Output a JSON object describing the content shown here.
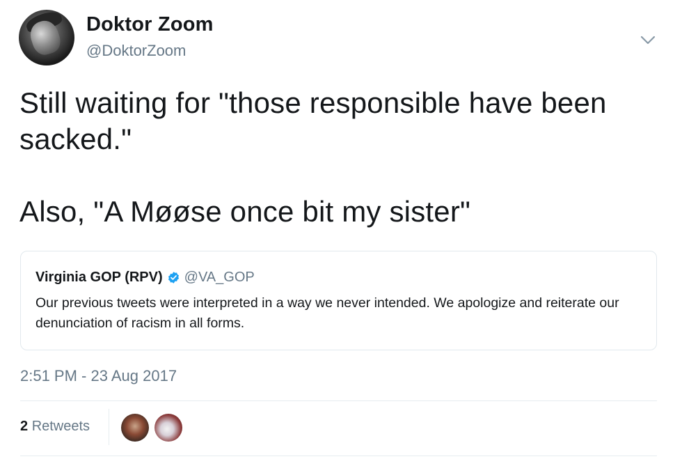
{
  "author": {
    "display_name": "Doktor Zoom",
    "handle": "@DoktorZoom",
    "avatar_icon": "user-avatar"
  },
  "menu": {
    "icon": "chevron-down-icon"
  },
  "tweet": {
    "text": "Still waiting for \"those responsible have been sacked.\"\n\nAlso, \"A Møøse once bit my sister\"",
    "timestamp": "2:51 PM - 23 Aug 2017"
  },
  "quoted_tweet": {
    "display_name": "Virginia GOP (RPV)",
    "verified": true,
    "verified_icon": "verified-badge-icon",
    "handle": "@VA_GOP",
    "text": "Our previous tweets were interpreted in a way we never intended. We apologize and reiterate our denunciation of racism in all forms."
  },
  "stats": {
    "retweet_count": "2",
    "retweet_label": "Retweets",
    "retweeter_avatars": [
      "retweeter-avatar-1",
      "retweeter-avatar-2"
    ]
  },
  "colors": {
    "text_primary": "#14171a",
    "text_secondary": "#657786",
    "border": "#e1e8ed",
    "verified_blue": "#1da1f2"
  }
}
